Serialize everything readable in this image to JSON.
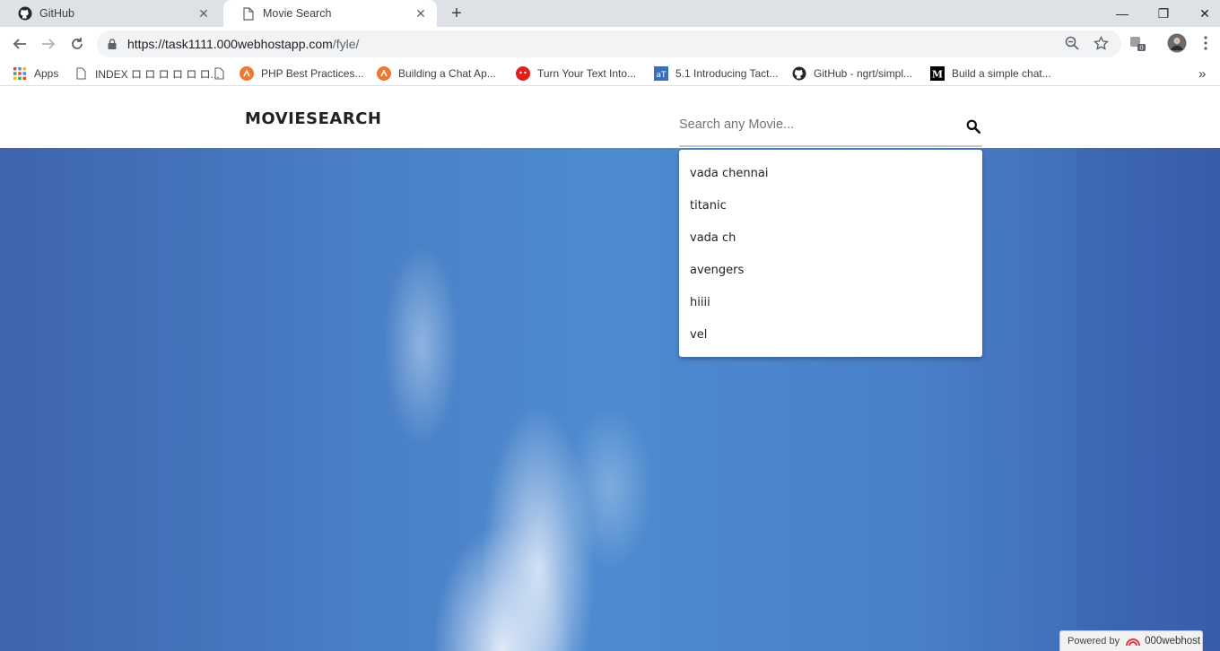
{
  "browser": {
    "tabs": [
      {
        "title": "GitHub",
        "active": false,
        "icon": "github-icon"
      },
      {
        "title": "Movie Search",
        "active": true,
        "icon": "page-icon"
      }
    ],
    "new_tab": "+",
    "window_controls": {
      "minimize": "—",
      "restore": "❐",
      "close": "✕"
    },
    "url": {
      "host": "https://task1111.000webhostapp.com",
      "path": "/fyle/"
    },
    "extension_badge": "0"
  },
  "bookmarks": [
    {
      "label": "Apps",
      "icon": "apps-grid-icon"
    },
    {
      "label": "INDEX ロ ロ ロ ロ ロ ロ...",
      "icon": "page-icon"
    },
    {
      "label": "",
      "icon": "page-icon"
    },
    {
      "label": "PHP Best Practices...",
      "icon": "orange-logo-icon"
    },
    {
      "label": "Building a Chat Ap...",
      "icon": "orange-logo-icon"
    },
    {
      "label": "Turn Your Text Into...",
      "icon": "red-circle-icon"
    },
    {
      "label": "5.1 Introducing Tact...",
      "icon": "tactics-icon"
    },
    {
      "label": "GitHub - ngrt/simpl...",
      "icon": "github-icon"
    },
    {
      "label": "Build a simple chat...",
      "icon": "medium-icon"
    }
  ],
  "bookmarks_overflow": "»",
  "site": {
    "brand": "MOVIESEARCH",
    "search_placeholder": "Search any Movie...",
    "suggestions": [
      "vada chennai",
      "titanic",
      "vada ch",
      "avengers",
      "hiiii",
      "vel"
    ],
    "powered_by": "Powered by",
    "host_brand": "000webhost"
  },
  "colors": {
    "tab_strip": "#dee1e6",
    "sky": "#4a80c6",
    "navbar": "#ffffff"
  }
}
